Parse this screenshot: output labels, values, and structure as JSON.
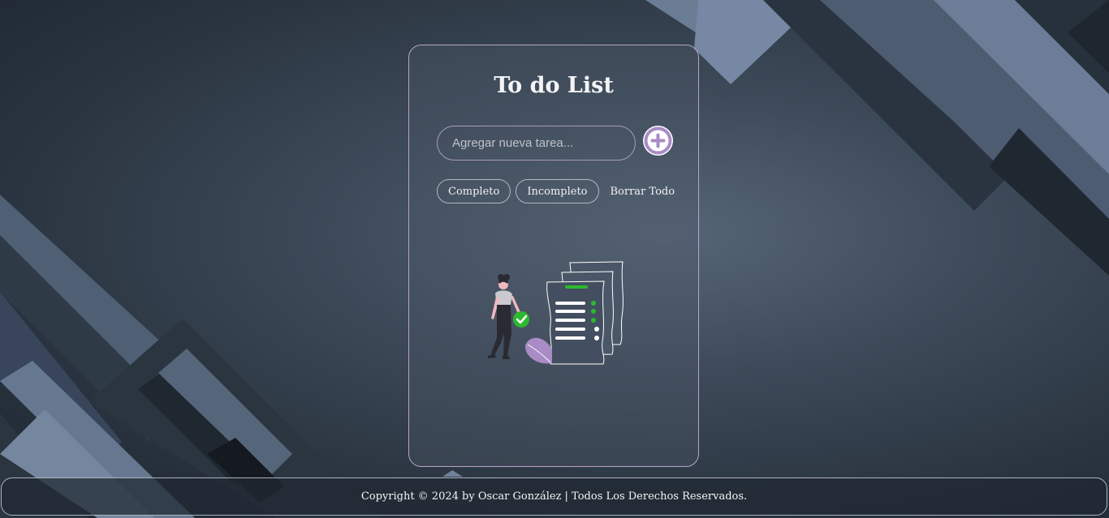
{
  "app": {
    "title": "To do List"
  },
  "input": {
    "placeholder": "Agregar nueva tarea...",
    "value": ""
  },
  "add_button": {
    "icon": "plus-circle-icon"
  },
  "filters": {
    "complete_label": "Completo",
    "incomplete_label": "Incompleto",
    "clear_label": "Borrar Todo"
  },
  "illustration": {
    "icon": "empty-tasks-illustration"
  },
  "footer": {
    "text": "Copyright © 2024 by Oscar González | Todos Los Derechos Reservados."
  },
  "colors": {
    "accent": "#a98bc6",
    "check_green": "#2db82d",
    "card_border": "#b9a3c9"
  }
}
